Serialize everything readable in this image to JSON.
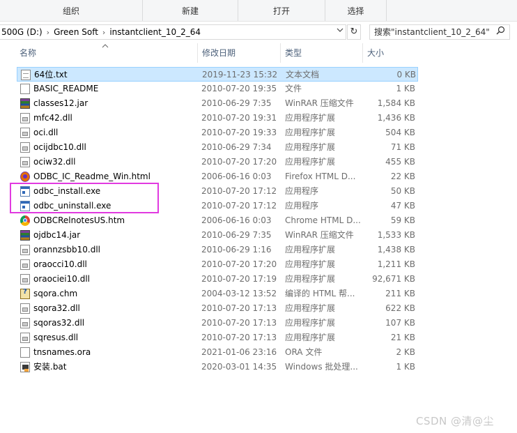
{
  "ribbon": {
    "groups": [
      "组织",
      "新建",
      "打开",
      "选择"
    ]
  },
  "address": {
    "crumbs": [
      "500G (D:)",
      "Green Soft",
      "instantclient_10_2_64"
    ],
    "separator": "›",
    "dropdown_icon": "chevron-down-icon",
    "refresh_glyph": "↻"
  },
  "search": {
    "placeholder": "搜索\"instantclient_10_2_64\"",
    "icon_glyph": "⌕"
  },
  "columns": {
    "name": "名称",
    "date": "修改日期",
    "type": "类型",
    "size": "大小"
  },
  "files": [
    {
      "name": "64位.txt",
      "date": "2019-11-23 15:32",
      "type": "文本文档",
      "size": "0 KB",
      "icon": "txt",
      "selected": true
    },
    {
      "name": "BASIC_README",
      "date": "2010-07-20 19:35",
      "type": "文件",
      "size": "1 KB",
      "icon": "file"
    },
    {
      "name": "classes12.jar",
      "date": "2010-06-29 7:35",
      "type": "WinRAR 压缩文件",
      "size": "1,584 KB",
      "icon": "jar"
    },
    {
      "name": "mfc42.dll",
      "date": "2010-07-20 19:31",
      "type": "应用程序扩展",
      "size": "1,436 KB",
      "icon": "dll"
    },
    {
      "name": "oci.dll",
      "date": "2010-07-20 19:33",
      "type": "应用程序扩展",
      "size": "504 KB",
      "icon": "dll"
    },
    {
      "name": "ocijdbc10.dll",
      "date": "2010-06-29 7:34",
      "type": "应用程序扩展",
      "size": "71 KB",
      "icon": "dll"
    },
    {
      "name": "ociw32.dll",
      "date": "2010-07-20 17:20",
      "type": "应用程序扩展",
      "size": "455 KB",
      "icon": "dll"
    },
    {
      "name": "ODBC_IC_Readme_Win.html",
      "date": "2006-06-16 0:03",
      "type": "Firefox HTML D...",
      "size": "22 KB",
      "icon": "html"
    },
    {
      "name": "odbc_install.exe",
      "date": "2010-07-20 17:12",
      "type": "应用程序",
      "size": "50 KB",
      "icon": "exe"
    },
    {
      "name": "odbc_uninstall.exe",
      "date": "2010-07-20 17:12",
      "type": "应用程序",
      "size": "47 KB",
      "icon": "exe"
    },
    {
      "name": "ODBCRelnotesUS.htm",
      "date": "2006-06-16 0:03",
      "type": "Chrome HTML D...",
      "size": "59 KB",
      "icon": "htm"
    },
    {
      "name": "ojdbc14.jar",
      "date": "2010-06-29 7:35",
      "type": "WinRAR 压缩文件",
      "size": "1,533 KB",
      "icon": "jar"
    },
    {
      "name": "orannzsbb10.dll",
      "date": "2010-06-29 1:16",
      "type": "应用程序扩展",
      "size": "1,438 KB",
      "icon": "dll"
    },
    {
      "name": "oraocci10.dll",
      "date": "2010-07-20 17:20",
      "type": "应用程序扩展",
      "size": "1,211 KB",
      "icon": "dll"
    },
    {
      "name": "oraociei10.dll",
      "date": "2010-07-20 17:19",
      "type": "应用程序扩展",
      "size": "92,671 KB",
      "icon": "dll"
    },
    {
      "name": "sqora.chm",
      "date": "2004-03-12 13:52",
      "type": "编译的 HTML 帮...",
      "size": "211 KB",
      "icon": "chm"
    },
    {
      "name": "sqora32.dll",
      "date": "2010-07-20 17:13",
      "type": "应用程序扩展",
      "size": "622 KB",
      "icon": "dll"
    },
    {
      "name": "sqoras32.dll",
      "date": "2010-07-20 17:13",
      "type": "应用程序扩展",
      "size": "107 KB",
      "icon": "dll"
    },
    {
      "name": "sqresus.dll",
      "date": "2010-07-20 17:13",
      "type": "应用程序扩展",
      "size": "21 KB",
      "icon": "dll"
    },
    {
      "name": "tnsnames.ora",
      "date": "2021-01-06 23:16",
      "type": "ORA 文件",
      "size": "2 KB",
      "icon": "file"
    },
    {
      "name": "安装.bat",
      "date": "2020-03-01 14:35",
      "type": "Windows 批处理...",
      "size": "1 KB",
      "icon": "bat"
    }
  ],
  "watermark": "CSDN @清@尘",
  "colors": {
    "selection_bg": "#cce8ff",
    "selection_border": "#99d1ff",
    "highlight_annotation": "#e13ae0",
    "header_text": "#4c607a"
  }
}
